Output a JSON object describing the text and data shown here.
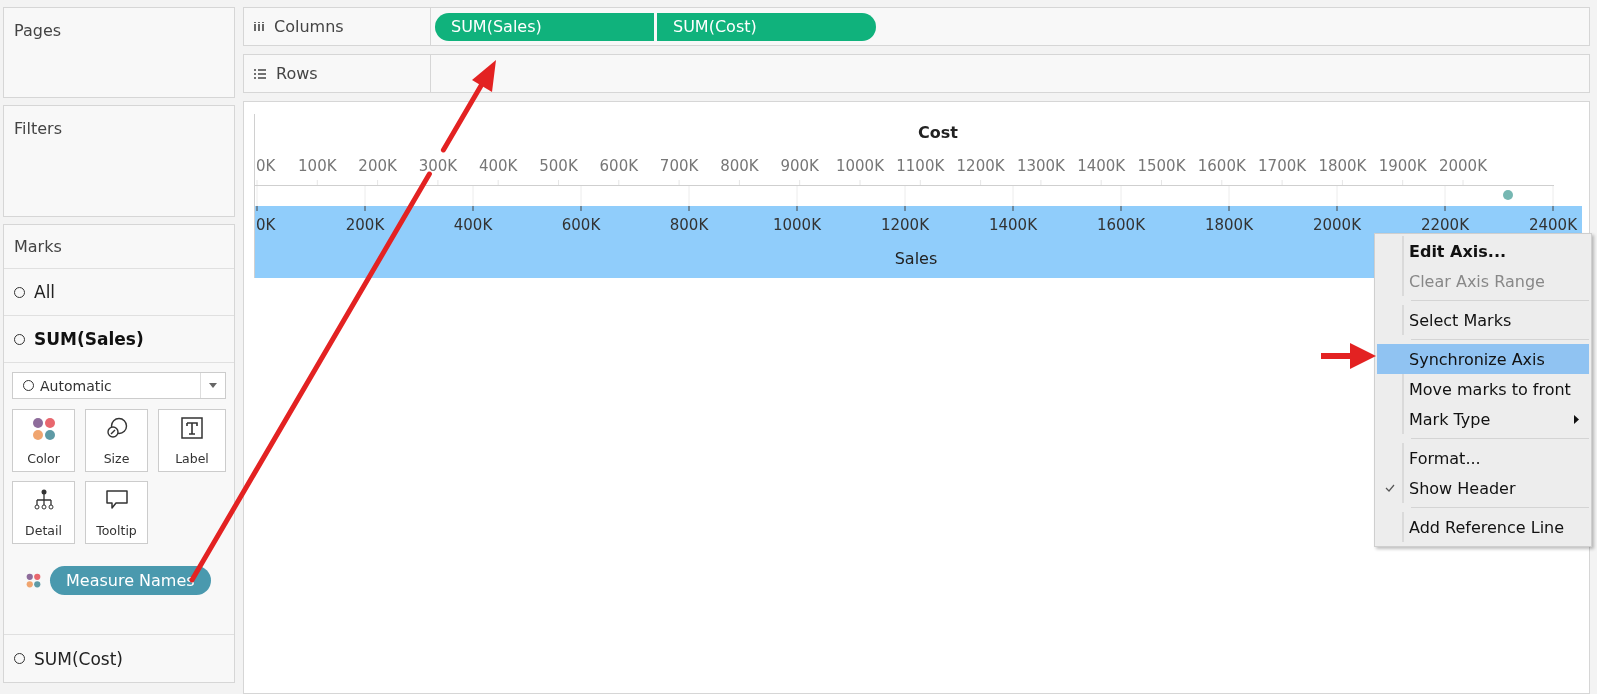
{
  "pages": {
    "title": "Pages"
  },
  "filters": {
    "title": "Filters"
  },
  "marks": {
    "title": "Marks",
    "layers": [
      {
        "label": "All",
        "selected": false
      },
      {
        "label": "SUM(Sales)",
        "selected": true
      }
    ],
    "mark_type": {
      "value": "Automatic"
    },
    "cards": [
      {
        "kind": "color",
        "label": "Color"
      },
      {
        "kind": "size",
        "label": "Size"
      },
      {
        "kind": "label",
        "label": "Label"
      },
      {
        "kind": "detail",
        "label": "Detail"
      },
      {
        "kind": "tooltip",
        "label": "Tooltip"
      }
    ],
    "fields": [
      {
        "kind": "color",
        "label": "Measure Names"
      }
    ],
    "more_layers": [
      {
        "label": "SUM(Cost)",
        "selected": false
      }
    ]
  },
  "columns_shelf": {
    "label": "Columns",
    "pills": [
      "SUM(Sales)",
      "SUM(Cost)"
    ]
  },
  "rows_shelf": {
    "label": "Rows"
  },
  "view": {
    "cost_axis": {
      "title": "Cost",
      "ticks": [
        "0K",
        "100K",
        "200K",
        "300K",
        "400K",
        "500K",
        "600K",
        "700K",
        "800K",
        "900K",
        "1000K",
        "1100K",
        "1200K",
        "1300K",
        "1400K",
        "1500K",
        "1600K",
        "1700K",
        "1800K",
        "1900K",
        "2000K"
      ]
    },
    "sales_axis": {
      "title": "Sales",
      "selected": true,
      "ticks": [
        "0K",
        "200K",
        "400K",
        "600K",
        "800K",
        "1000K",
        "1200K",
        "1400K",
        "1600K",
        "1800K",
        "2000K",
        "2200K",
        "2400K"
      ]
    }
  },
  "context_menu": {
    "items": [
      {
        "kind": "item",
        "label": "Edit Axis...",
        "bold": true,
        "disabled": false,
        "selected": false,
        "checked": false,
        "submenu": false
      },
      {
        "kind": "item",
        "label": "Clear Axis Range",
        "bold": false,
        "disabled": true,
        "selected": false,
        "checked": false,
        "submenu": false
      },
      {
        "kind": "separator"
      },
      {
        "kind": "item",
        "label": "Select Marks",
        "bold": false,
        "disabled": false,
        "selected": false,
        "checked": false,
        "submenu": false
      },
      {
        "kind": "separator"
      },
      {
        "kind": "item",
        "label": "Synchronize Axis",
        "bold": false,
        "disabled": false,
        "selected": true,
        "checked": false,
        "submenu": false
      },
      {
        "kind": "item",
        "label": "Move marks to front",
        "bold": false,
        "disabled": false,
        "selected": false,
        "checked": false,
        "submenu": false
      },
      {
        "kind": "item",
        "label": "Mark Type",
        "bold": false,
        "disabled": false,
        "selected": false,
        "checked": false,
        "submenu": true
      },
      {
        "kind": "separator"
      },
      {
        "kind": "item",
        "label": "Format...",
        "bold": false,
        "disabled": false,
        "selected": false,
        "checked": false,
        "submenu": false
      },
      {
        "kind": "item",
        "label": "Show Header",
        "bold": false,
        "disabled": false,
        "selected": false,
        "checked": true,
        "submenu": false
      },
      {
        "kind": "separator"
      },
      {
        "kind": "item",
        "label": "Add Reference Line",
        "bold": false,
        "disabled": false,
        "selected": false,
        "checked": false,
        "submenu": false
      }
    ]
  }
}
